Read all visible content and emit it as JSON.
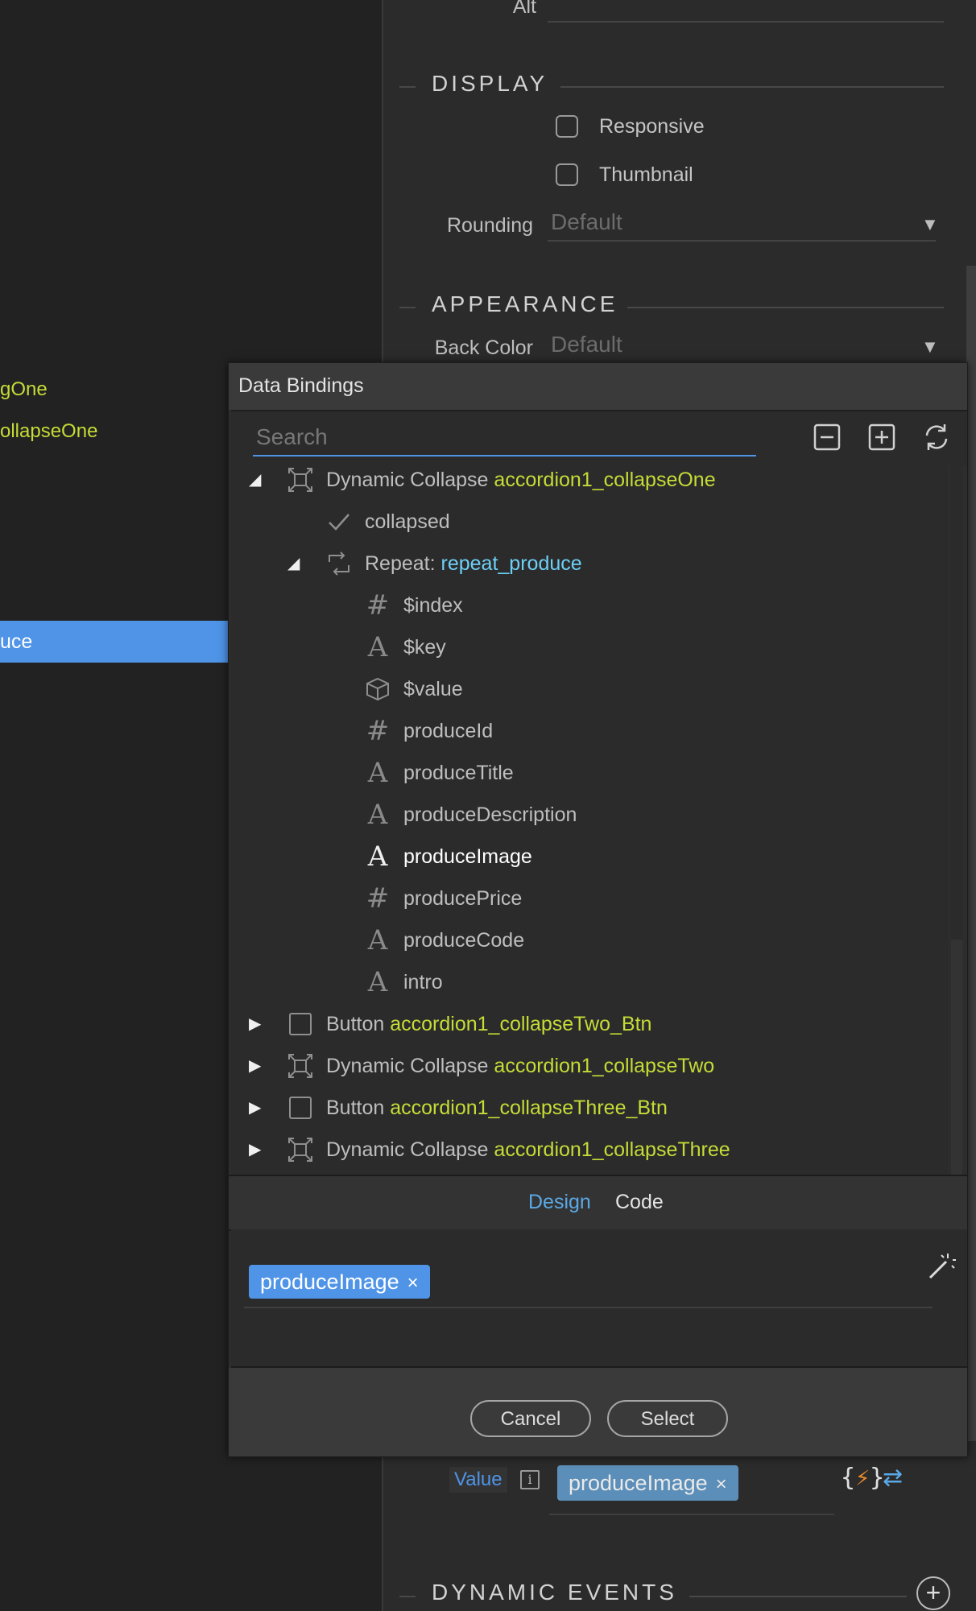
{
  "left_tree": {
    "items": [
      "gOne",
      "ollapseOne"
    ],
    "selected": "uce"
  },
  "properties": {
    "alt_label": "Alt",
    "display": {
      "title": "DISPLAY",
      "responsive_label": "Responsive",
      "thumbnail_label": "Thumbnail",
      "rounding_label": "Rounding",
      "rounding_value": "Default"
    },
    "appearance": {
      "title": "APPEARANCE",
      "back_color_label": "Back Color",
      "back_color_value": "Default"
    },
    "value_label": "Value",
    "value_chip": "produceImage",
    "dynamic_events_title": "DYNAMIC EVENTS"
  },
  "dialog": {
    "title": "Data Bindings",
    "search_placeholder": "Search",
    "tree": [
      {
        "expander": "◢",
        "type": "Dynamic Collapse ",
        "name": "accordion1_collapseOne",
        "name_color": "green",
        "icon": "dynamic-collapse-icon"
      },
      {
        "type": "collapsed",
        "icon": "check-icon"
      },
      {
        "expander": "◢",
        "type": "Repeat: ",
        "name": "repeat_produce",
        "name_color": "blue",
        "icon": "repeat-icon"
      },
      {
        "type": "$index",
        "icon": "number-icon",
        "glyph": "#"
      },
      {
        "type": "$key",
        "icon": "text-icon",
        "glyph": "A"
      },
      {
        "type": "$value",
        "icon": "object-icon"
      },
      {
        "type": "produceId",
        "icon": "number-icon",
        "glyph": "#"
      },
      {
        "type": "produceTitle",
        "icon": "text-icon",
        "glyph": "A"
      },
      {
        "type": "produceDescription",
        "icon": "text-icon",
        "glyph": "A"
      },
      {
        "type": "produceImage",
        "icon": "text-icon",
        "glyph": "A",
        "selected": true
      },
      {
        "type": "producePrice",
        "icon": "number-icon",
        "glyph": "#"
      },
      {
        "type": "produceCode",
        "icon": "text-icon",
        "glyph": "A"
      },
      {
        "type": "intro",
        "icon": "text-icon",
        "glyph": "A"
      },
      {
        "expander": "▶",
        "type": "Button ",
        "name": "accordion1_collapseTwo_Btn",
        "name_color": "green",
        "icon": "button-icon"
      },
      {
        "expander": "▶",
        "type": "Dynamic Collapse ",
        "name": "accordion1_collapseTwo",
        "name_color": "green",
        "icon": "dynamic-collapse-icon"
      },
      {
        "expander": "▶",
        "type": "Button ",
        "name": "accordion1_collapseThree_Btn",
        "name_color": "green",
        "icon": "button-icon"
      },
      {
        "expander": "▶",
        "type": "Dynamic Collapse ",
        "name": "accordion1_collapseThree",
        "name_color": "green",
        "icon": "dynamic-collapse-icon"
      }
    ],
    "tabs": [
      "Design",
      "Code"
    ],
    "active_tab": "Design",
    "expression_chip": "produceImage",
    "cancel_label": "Cancel",
    "select_label": "Select"
  },
  "colors": {
    "accent_blue": "#4f94e7",
    "highlight_green": "#c6dc36",
    "highlight_cyan": "#6ecff6"
  }
}
